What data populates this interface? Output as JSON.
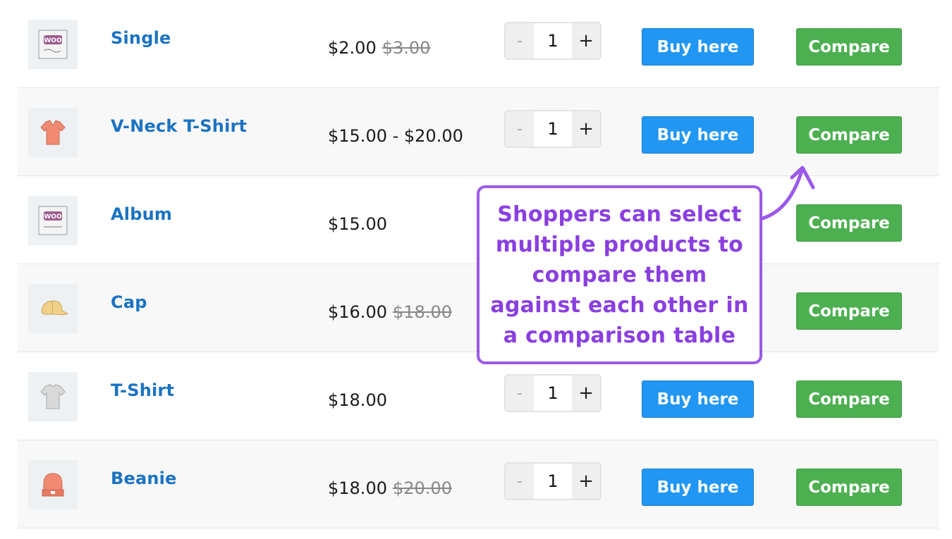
{
  "products": [
    {
      "name": "Single",
      "price": "$2.00",
      "old_price": "$3.00",
      "qty": "1",
      "buy_label": "Buy here",
      "compare_label": "Compare",
      "image": "woo-single-icon"
    },
    {
      "name": "V-Neck T-Shirt",
      "price": "$15.00 - $20.00",
      "old_price": "",
      "qty": "1",
      "buy_label": "Buy here",
      "compare_label": "Compare",
      "image": "vneck-shirt-icon"
    },
    {
      "name": "Album",
      "price": "$15.00",
      "old_price": "",
      "qty": "",
      "buy_label": "",
      "compare_label": "Compare",
      "image": "woo-album-icon"
    },
    {
      "name": "Cap",
      "price": "$16.00",
      "old_price": "$18.00",
      "qty": "",
      "buy_label": "",
      "compare_label": "Compare",
      "image": "cap-icon"
    },
    {
      "name": "T-Shirt",
      "price": "$18.00",
      "old_price": "",
      "qty": "1",
      "buy_label": "Buy here",
      "compare_label": "Compare",
      "image": "tshirt-icon"
    },
    {
      "name": "Beanie",
      "price": "$18.00",
      "old_price": "$20.00",
      "qty": "1",
      "buy_label": "Buy here",
      "compare_label": "Compare",
      "image": "beanie-icon"
    }
  ],
  "qty_controls": {
    "minus": "-",
    "plus": "+"
  },
  "callout": {
    "text": "Shoppers can select multiple products to compare them against each other in a comparison table"
  },
  "colors": {
    "link": "#1b73c2",
    "buy": "#2196f3",
    "compare": "#4caf50",
    "callout": "#9b59e8"
  }
}
